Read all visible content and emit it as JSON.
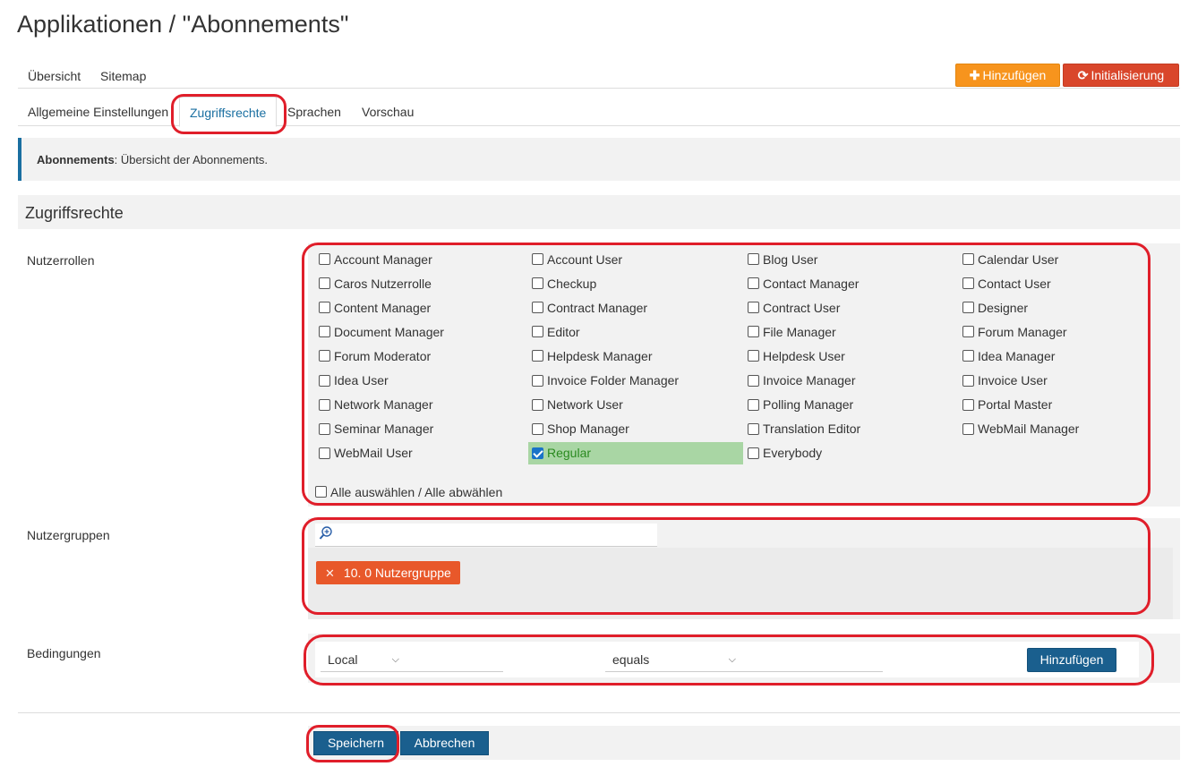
{
  "page": {
    "title": "Applikationen / \"Abonnements\""
  },
  "topnav": {
    "items": [
      "Übersicht",
      "Sitemap"
    ],
    "add_label": "Hinzufügen",
    "init_label": "Initialisierung"
  },
  "tabs": [
    "Allgemeine Einstellungen",
    "Zugriffsrechte",
    "Sprachen",
    "Vorschau"
  ],
  "active_tab": "Zugriffsrechte",
  "info": {
    "bold": "Abonnements",
    "text": ": Übersicht der Abonnements."
  },
  "section": {
    "title": "Zugriffsrechte"
  },
  "roles": {
    "label": "Nutzerrollen",
    "items": [
      {
        "label": "Account Manager",
        "checked": false
      },
      {
        "label": "Account User",
        "checked": false
      },
      {
        "label": "Blog User",
        "checked": false
      },
      {
        "label": "Calendar User",
        "checked": false
      },
      {
        "label": "Caros Nutzerrolle",
        "checked": false
      },
      {
        "label": "Checkup",
        "checked": false
      },
      {
        "label": "Contact Manager",
        "checked": false
      },
      {
        "label": "Contact User",
        "checked": false
      },
      {
        "label": "Content Manager",
        "checked": false
      },
      {
        "label": "Contract Manager",
        "checked": false
      },
      {
        "label": "Contract User",
        "checked": false
      },
      {
        "label": "Designer",
        "checked": false
      },
      {
        "label": "Document Manager",
        "checked": false
      },
      {
        "label": "Editor",
        "checked": false
      },
      {
        "label": "File Manager",
        "checked": false
      },
      {
        "label": "Forum Manager",
        "checked": false
      },
      {
        "label": "Forum Moderator",
        "checked": false
      },
      {
        "label": "Helpdesk Manager",
        "checked": false
      },
      {
        "label": "Helpdesk User",
        "checked": false
      },
      {
        "label": "Idea Manager",
        "checked": false
      },
      {
        "label": "Idea User",
        "checked": false
      },
      {
        "label": "Invoice Folder Manager",
        "checked": false
      },
      {
        "label": "Invoice Manager",
        "checked": false
      },
      {
        "label": "Invoice User",
        "checked": false
      },
      {
        "label": "Network Manager",
        "checked": false
      },
      {
        "label": "Network User",
        "checked": false
      },
      {
        "label": "Polling Manager",
        "checked": false
      },
      {
        "label": "Portal Master",
        "checked": false
      },
      {
        "label": "Seminar Manager",
        "checked": false
      },
      {
        "label": "Shop Manager",
        "checked": false
      },
      {
        "label": "Translation Editor",
        "checked": false
      },
      {
        "label": "WebMail Manager",
        "checked": false
      },
      {
        "label": "WebMail User",
        "checked": false
      },
      {
        "label": "Regular",
        "checked": true
      },
      {
        "label": "Everybody",
        "checked": false
      }
    ],
    "select_all_label": "Alle auswählen / Alle abwählen"
  },
  "groups": {
    "label": "Nutzergruppen",
    "search_value": "",
    "selected": [
      "10. 0 Nutzergruppe"
    ],
    "search_icon": "magnifier-plus-icon"
  },
  "conditions": {
    "label": "Bedingungen",
    "field_value": "Local",
    "operator_value": "equals",
    "add_label": "Hinzufügen"
  },
  "footer": {
    "save_label": "Speichern",
    "cancel_label": "Abbrechen"
  },
  "colors": {
    "accent": "#1a6fa1",
    "orange": "#f7941d",
    "red": "#d9462b",
    "chip": "#e8582a",
    "selected_bg": "#a9d6a4",
    "annotation": "#e01e2a"
  }
}
